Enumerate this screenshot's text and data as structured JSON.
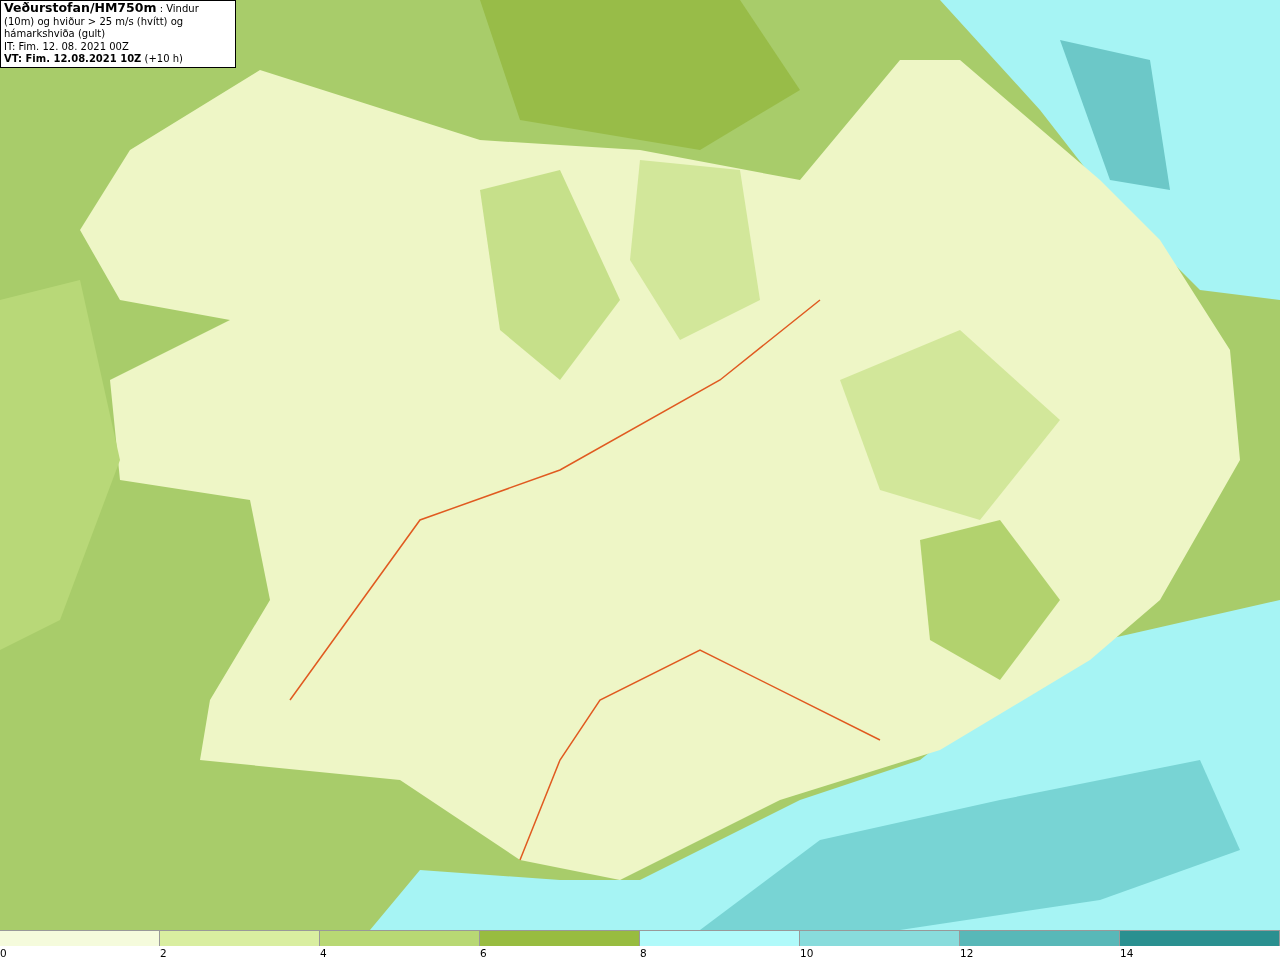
{
  "title_box": {
    "lines": [
      "**Veðurstofan/HM750m** : Vindur (10m) og hviður > 25 m/s (hvítt) og hámarkshviða (gult)",
      "IT: Fim. 12. 08. 2021 00Z",
      "**VT: Fim. 12.08.2021 10Z** (+10 h)"
    ]
  },
  "legend": {
    "bins": [
      {
        "label": "0",
        "color": "#f5fbdc"
      },
      {
        "label": "2",
        "color": "#d9eea0"
      },
      {
        "label": "4",
        "color": "#b8d874"
      },
      {
        "label": "6",
        "color": "#98bc40"
      },
      {
        "label": "8",
        "color": "#b0fafa"
      },
      {
        "label": "10",
        "color": "#88dcdc"
      },
      {
        "label": "12",
        "color": "#58b8b8"
      },
      {
        "label": "14",
        "color": "#2a9090"
      }
    ]
  }
}
